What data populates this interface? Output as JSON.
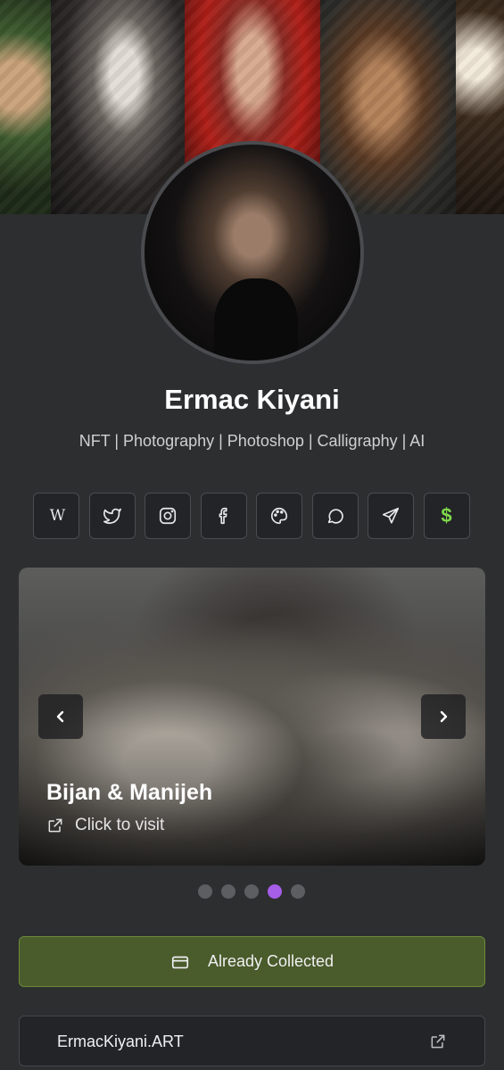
{
  "profile": {
    "name": "Ermac Kiyani",
    "tagline": "NFT | Photography | Photoshop | Calligraphy | AI"
  },
  "socials": [
    {
      "icon": "wikipedia-icon",
      "label": "W"
    },
    {
      "icon": "twitter-icon"
    },
    {
      "icon": "instagram-icon"
    },
    {
      "icon": "facebook-icon"
    },
    {
      "icon": "palette-icon"
    },
    {
      "icon": "chat-icon"
    },
    {
      "icon": "send-icon"
    },
    {
      "icon": "dollar-icon",
      "label": "$",
      "color": "#7fd84a"
    }
  ],
  "carousel": {
    "title": "Bijan & Manijeh",
    "visit_label": "Click to visit",
    "slide_count": 5,
    "active_slide": 4
  },
  "actions": {
    "collected_label": "Already Collected",
    "website_label": "ErmacKiyani.ART"
  },
  "colors": {
    "background": "#2d2e30",
    "collected_bg": "#4a5b2c",
    "active_dot": "#a65de8"
  }
}
